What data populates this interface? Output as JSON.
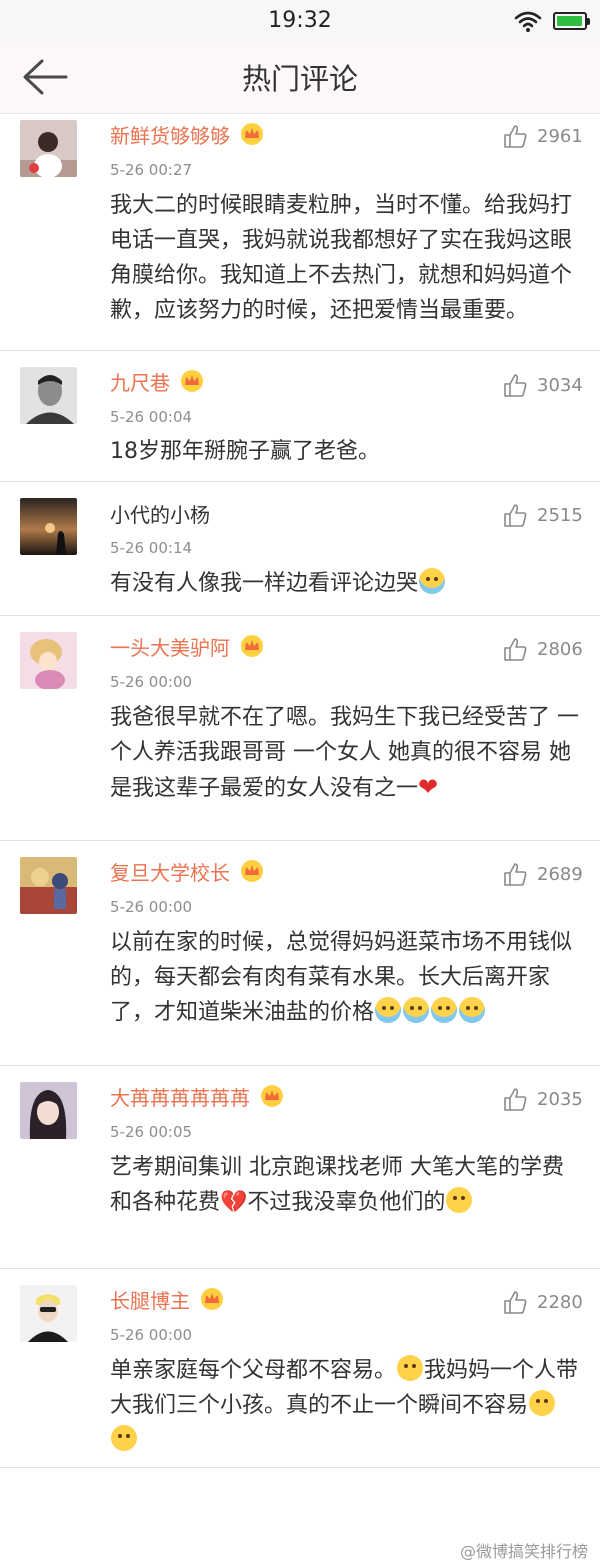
{
  "status_bar": {
    "time": "19:32",
    "battery_level": 0.95
  },
  "header": {
    "title": "热门评论"
  },
  "comments": [
    {
      "name": "新鲜货够够够",
      "vip": true,
      "likes": "2961",
      "time": "5-26 00:27",
      "text": "我大二的时候眼睛麦粒肿，当时不懂。给我妈打电话一直哭，我妈就说我都想好了实在我妈这眼角膜给你。我知道上不去热门，就想和妈妈道个歉，应该努力的时候，还把爱情当最重要。"
    },
    {
      "name": "九尺巷",
      "vip": true,
      "likes": "3034",
      "time": "5-26 00:04",
      "text": "18岁那年掰腕子赢了老爸。"
    },
    {
      "name": "小代的小杨",
      "vip": false,
      "likes": "2515",
      "time": "5-26 00:14",
      "text": "有没有人像我一样边看评论边哭"
    },
    {
      "name": "一头大美驴阿",
      "vip": true,
      "likes": "2806",
      "time": "5-26 00:00",
      "text": "我爸很早就不在了嗯。我妈生下我已经受苦了 一个人养活我跟哥哥 一个女人 她真的很不容易 她是我这辈子最爱的女人没有之一"
    },
    {
      "name": "复旦大学校长",
      "vip": true,
      "likes": "2689",
      "time": "5-26 00:00",
      "text": "以前在家的时候，总觉得妈妈逛菜市场不用钱似的，每天都会有肉有菜有水果。长大后离开家了，才知道柴米油盐的价格"
    },
    {
      "name": "大苒苒苒苒苒苒",
      "vip": true,
      "likes": "2035",
      "time": "5-26 00:05",
      "text_a": "艺考期间集训  北京跑课找老师  大笔大笔的学费和各种花费",
      "text_b": "不过我没辜负他们的"
    },
    {
      "name": "长腿博主",
      "vip": true,
      "likes": "2280",
      "time": "5-26 00:00",
      "text_a": "单亲家庭每个父母都不容易。",
      "text_b": "我妈妈一个人带大我们三个小孩。真的不止一个瞬间不容易"
    }
  ],
  "watermark": "@微博搞笑排行榜",
  "icons": {
    "back": "back-arrow-icon",
    "like": "thumbs-up-icon",
    "vip": "crown-badge-icon"
  },
  "colors": {
    "vip_name": "#eb7350",
    "battery": "#2fbd3f"
  }
}
